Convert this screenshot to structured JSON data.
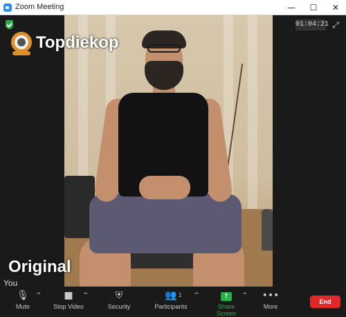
{
  "window": {
    "title": "Zoom Meeting",
    "minimize_glyph": "—",
    "maximize_glyph": "☐",
    "close_glyph": "✕"
  },
  "meeting": {
    "timer": "01:04:21",
    "brand_name": "Topdiekop",
    "overlay_caption": "Original",
    "self_label": "You",
    "encryption_icon": "shield-check-icon"
  },
  "toolbar": {
    "mute": {
      "label": "Mute",
      "icon": "microphone-icon",
      "glyph": "🎙"
    },
    "stop_video": {
      "label": "Stop Video",
      "icon": "video-camera-icon",
      "glyph": "■"
    },
    "security": {
      "label": "Security",
      "icon": "shield-icon",
      "glyph": "⛨"
    },
    "participants": {
      "label": "Participants",
      "icon": "participants-icon",
      "glyph": "👥",
      "count": "1"
    },
    "share_screen": {
      "label": "Share Screen",
      "icon": "share-arrow-icon",
      "glyph": "↑",
      "color": "#27b04a"
    },
    "more": {
      "label": "More",
      "icon": "ellipsis-icon",
      "glyph": "•••"
    },
    "end": {
      "label": "End",
      "color": "#e02828"
    },
    "caret_glyph": "^"
  }
}
